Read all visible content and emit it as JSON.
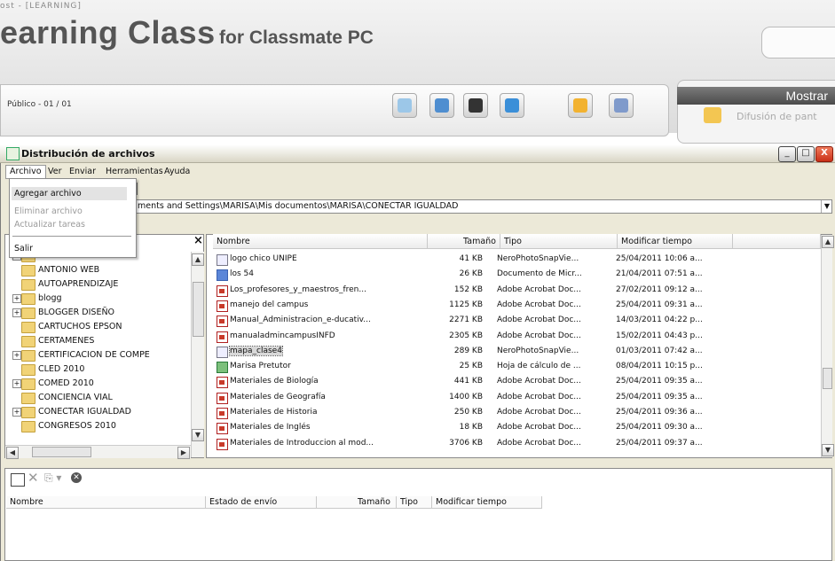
{
  "background_app": {
    "cut_title": "ost - [LEARNING]",
    "title": "earning Class",
    "subtitle": "for Classmate PC",
    "public_label": "Público - 01 / 01",
    "mostrar_label": "Mostrar",
    "difusion_label": "Difusión de pant"
  },
  "window": {
    "title": "Distribución de archivos",
    "minimize": "_",
    "maximize": "□",
    "close": "X"
  },
  "menubar": [
    "Archivo",
    "Ver",
    "Enviar",
    "Herramientas",
    "Ayuda"
  ],
  "archivo_menu": {
    "items": [
      {
        "label": "Agregar archivo",
        "enabled": true
      },
      {
        "label": "Eliminar archivo",
        "enabled": false
      },
      {
        "label": "Actualizar tareas",
        "enabled": false
      },
      {
        "label": "Salir",
        "enabled": true
      }
    ]
  },
  "address": {
    "path": "ments and Settings\\MARISA\\Mis documentos\\MARISA\\CONECTAR IGUALDAD"
  },
  "tree": {
    "close": "×",
    "items": [
      {
        "label": "ROBERTS",
        "exp": "+"
      },
      {
        "label": "ANTONIO WEB",
        "exp": ""
      },
      {
        "label": "AUTOAPRENDIZAJE",
        "exp": ""
      },
      {
        "label": "blogg",
        "exp": "+"
      },
      {
        "label": "BLOGGER DISEÑO",
        "exp": "+"
      },
      {
        "label": "CARTUCHOS EPSON",
        "exp": ""
      },
      {
        "label": "CERTAMENES",
        "exp": ""
      },
      {
        "label": "CERTIFICACION DE COMPE",
        "exp": "+"
      },
      {
        "label": "CLED 2010",
        "exp": ""
      },
      {
        "label": "COMED 2010",
        "exp": "+"
      },
      {
        "label": "CONCIENCIA VIAL",
        "exp": ""
      },
      {
        "label": "CONECTAR IGUALDAD",
        "exp": "+"
      },
      {
        "label": "CONGRESOS 2010",
        "exp": ""
      }
    ]
  },
  "file_list": {
    "columns": [
      "Nombre",
      "Tamaño",
      "Tipo",
      "Modificar tiempo"
    ],
    "rows": [
      {
        "icon": "img",
        "name": "logo chico UNIPE",
        "size": "41 KB",
        "type": "NeroPhotoSnapVie...",
        "modified": "25/04/2011 10:06 a..."
      },
      {
        "icon": "doc",
        "name": "los 54",
        "size": "26 KB",
        "type": "Documento de Micr...",
        "modified": "21/04/2011 07:51 a..."
      },
      {
        "icon": "pdf",
        "name": "Los_profesores_y_maestros_fren...",
        "size": "152 KB",
        "type": "Adobe Acrobat Doc...",
        "modified": "27/02/2011 09:12 a..."
      },
      {
        "icon": "pdf",
        "name": "manejo del campus",
        "size": "1125 KB",
        "type": "Adobe Acrobat Doc...",
        "modified": "25/04/2011 09:31 a..."
      },
      {
        "icon": "pdf",
        "name": "Manual_Administracion_e-ducativ...",
        "size": "2271 KB",
        "type": "Adobe Acrobat Doc...",
        "modified": "14/03/2011 04:22 p..."
      },
      {
        "icon": "pdf",
        "name": "manualadmincampusINFD",
        "size": "2305 KB",
        "type": "Adobe Acrobat Doc...",
        "modified": "15/02/2011 04:43 p..."
      },
      {
        "icon": "img",
        "name": "mapa_clase4",
        "size": "289 KB",
        "type": "NeroPhotoSnapVie...",
        "modified": "01/03/2011 07:42 a...",
        "selected": true
      },
      {
        "icon": "xls",
        "name": "Marisa Pretutor",
        "size": "25 KB",
        "type": "Hoja de cálculo de ...",
        "modified": "08/04/2011 10:15 p..."
      },
      {
        "icon": "pdf",
        "name": "Materiales de Biología",
        "size": "441 KB",
        "type": "Adobe Acrobat Doc...",
        "modified": "25/04/2011 09:35 a..."
      },
      {
        "icon": "pdf",
        "name": "Materiales de Geografía",
        "size": "1400 KB",
        "type": "Adobe Acrobat Doc...",
        "modified": "25/04/2011 09:35 a..."
      },
      {
        "icon": "pdf",
        "name": "Materiales de Historia",
        "size": "250 KB",
        "type": "Adobe Acrobat Doc...",
        "modified": "25/04/2011 09:36 a..."
      },
      {
        "icon": "pdf",
        "name": "Materiales de Inglés",
        "size": "18 KB",
        "type": "Adobe Acrobat Doc...",
        "modified": "25/04/2011 09:30 a..."
      },
      {
        "icon": "pdf",
        "name": "Materiales de Introduccion al mod...",
        "size": "3706 KB",
        "type": "Adobe Acrobat Doc...",
        "modified": "25/04/2011 09:37 a..."
      }
    ]
  },
  "send_list": {
    "columns": [
      "Nombre",
      "Estado de envío",
      "Tamaño",
      "Tipo",
      "Modificar tiempo"
    ]
  }
}
